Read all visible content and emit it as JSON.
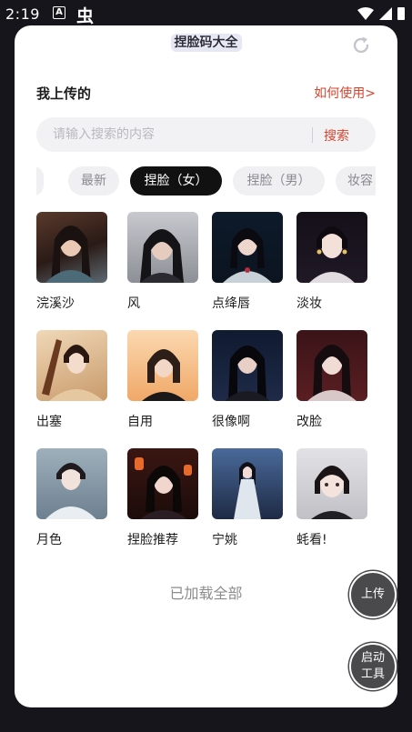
{
  "status_bar": {
    "time": "2:19",
    "a_icon": "A",
    "bug_icon": "虫"
  },
  "header": {
    "title": "捏脸码大全"
  },
  "section": {
    "label": "我上传的",
    "help_link": "如何使用>"
  },
  "search": {
    "placeholder": "请输入搜索的内容",
    "value": "",
    "button": "搜索"
  },
  "tabs": [
    {
      "label": "最新",
      "active": false
    },
    {
      "label": "捏脸（女）",
      "active": true
    },
    {
      "label": "捏脸（男）",
      "active": false
    },
    {
      "label": "妆容（",
      "active": false
    }
  ],
  "items": [
    {
      "label": "浣溪沙"
    },
    {
      "label": "风"
    },
    {
      "label": "点绛唇"
    },
    {
      "label": "淡妆"
    },
    {
      "label": "出塞"
    },
    {
      "label": "自用"
    },
    {
      "label": "很像啊"
    },
    {
      "label": "改脸"
    },
    {
      "label": "月色"
    },
    {
      "label": "捏脸推荐"
    },
    {
      "label": "宁姚"
    },
    {
      "label": "蚝看!"
    }
  ],
  "footer": {
    "loaded_all": "已加载全部"
  },
  "fab": {
    "upload": "上传",
    "launch_line1": "启动",
    "launch_line2": "工具"
  },
  "colors": {
    "accent": "#d4452f",
    "active_tab": "#111111"
  }
}
